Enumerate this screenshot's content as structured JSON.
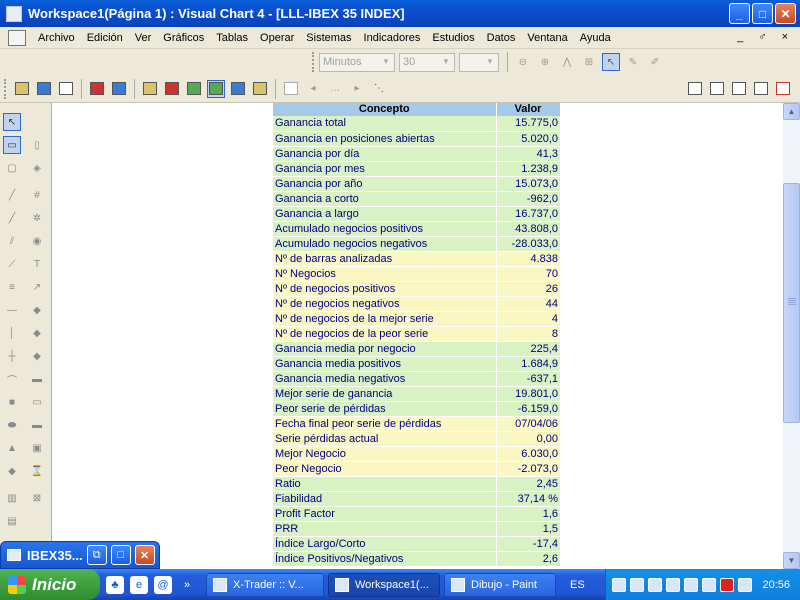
{
  "window": {
    "title": "Workspace1(Página 1) : Visual Chart 4 - [LLL-IBEX 35 INDEX]",
    "min": "_",
    "max": "□",
    "close": "✕"
  },
  "menu": {
    "items": [
      "Archivo",
      "Edición",
      "Ver",
      "Gráficos",
      "Tablas",
      "Operar",
      "Sistemas",
      "Indicadores",
      "Estudios",
      "Datos",
      "Ventana",
      "Ayuda"
    ],
    "mdi_controls": "_ ♂ ×"
  },
  "toolbar": {
    "timeframe": "Minutos",
    "interval": "30",
    "extra": ""
  },
  "table": {
    "headers": [
      "Concepto",
      "Valor"
    ],
    "rows": [
      {
        "label": "Ganancia total",
        "value": "15.775,0",
        "color": "green"
      },
      {
        "label": "Ganancia en posiciones abiertas",
        "value": "5.020,0",
        "color": "green"
      },
      {
        "label": "Ganancia por día",
        "value": "41,3",
        "color": "green"
      },
      {
        "label": "Ganancia por mes",
        "value": "1.238,9",
        "color": "green"
      },
      {
        "label": "Ganancia por año",
        "value": "15.073,0",
        "color": "green"
      },
      {
        "label": "Ganancia a corto",
        "value": "-962,0",
        "color": "green"
      },
      {
        "label": "Ganancia a largo",
        "value": "16.737,0",
        "color": "green"
      },
      {
        "label": "Acumulado negocios positivos",
        "value": "43.808,0",
        "color": "green"
      },
      {
        "label": "Acumulado negocios negativos",
        "value": "-28.033,0",
        "color": "green"
      },
      {
        "label": "Nº de barras analizadas",
        "value": "4.838",
        "color": "yellow"
      },
      {
        "label": "Nº Negocios",
        "value": "70",
        "color": "yellow"
      },
      {
        "label": "Nº de negocios positivos",
        "value": "26",
        "color": "yellow"
      },
      {
        "label": "Nº de negocios negativos",
        "value": "44",
        "color": "yellow"
      },
      {
        "label": "Nº de negocios de la mejor serie",
        "value": "4",
        "color": "yellow"
      },
      {
        "label": "Nº de negocios de la peor serie",
        "value": "8",
        "color": "yellow"
      },
      {
        "label": "Ganancia media por negocio",
        "value": "225,4",
        "color": "green"
      },
      {
        "label": "Ganancia media positivos",
        "value": "1.684,9",
        "color": "green"
      },
      {
        "label": "Ganancia media negativos",
        "value": "-637,1",
        "color": "green"
      },
      {
        "label": "Mejor serie de ganancia",
        "value": "19.801,0",
        "color": "green"
      },
      {
        "label": "Peor serie de pérdidas",
        "value": "-6.159,0",
        "color": "green"
      },
      {
        "label": "Fecha final peor serie de pérdidas",
        "value": "07/04/06",
        "color": "yellow"
      },
      {
        "label": "Serie pérdidas actual",
        "value": "0,00",
        "color": "yellow"
      },
      {
        "label": "Mejor Negocio",
        "value": "6.030,0",
        "color": "yellow"
      },
      {
        "label": "Peor Negocio",
        "value": "-2.073,0",
        "color": "yellow"
      },
      {
        "label": "Ratio",
        "value": "2,45",
        "color": "green"
      },
      {
        "label": "Fiabilidad",
        "value": "37,14 %",
        "color": "green"
      },
      {
        "label": "Profit Factor",
        "value": "1,6",
        "color": "green"
      },
      {
        "label": "PRR",
        "value": "1,5",
        "color": "green"
      },
      {
        "label": "Índice Largo/Corto",
        "value": "-17,4",
        "color": "green"
      },
      {
        "label": "Índice Positivos/Negativos",
        "value": "2,6",
        "color": "green"
      }
    ]
  },
  "minimized_window": {
    "title": "IBEX35..."
  },
  "taskbar": {
    "start_label": "Inicio",
    "tasks": [
      "X-Trader :: V...",
      "Workspace1(...",
      "Dibujo - Paint"
    ],
    "language": "ES",
    "clock": "20:56"
  },
  "colors": {
    "header_blue": "#a6c9e7",
    "row_green": "#d8f2c4",
    "row_yellow": "#fbf7c3",
    "title_blue": "#0b4fd0"
  }
}
